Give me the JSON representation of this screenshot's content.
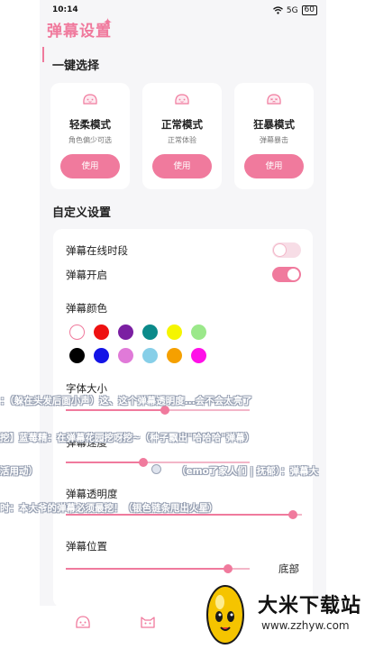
{
  "status_bar": {
    "time": "10:14",
    "wifi": "WiFi",
    "signal": "5G",
    "battery": "60"
  },
  "header": {
    "brand": "弹幕设置"
  },
  "quick_select": {
    "title": "一键选择",
    "modes": [
      {
        "name": "轻柔模式",
        "desc": "角色偏少可选",
        "button": "使用"
      },
      {
        "name": "正常模式",
        "desc": "正常体验",
        "button": "使用"
      },
      {
        "name": "狂暴模式",
        "desc": "弹幕暴击",
        "button": "使用"
      }
    ]
  },
  "custom": {
    "title": "自定义设置",
    "online_period": {
      "label": "弹幕在线时段",
      "on": false
    },
    "danmaku_on": {
      "label": "弹幕开启",
      "on": true
    },
    "color": {
      "label": "弹幕颜色",
      "swatches": [
        "#ffffff",
        "#ee1111",
        "#7b1fa2",
        "#0b8a8a",
        "#f5f500",
        "#9be88a",
        "#000000",
        "#1414e6",
        "#e07ad8",
        "#87cfe8",
        "#f5a000",
        "#ff10e8"
      ],
      "selected_index": 0
    },
    "font_size": {
      "label": "字体大小",
      "value": 0.54
    },
    "speed": {
      "label": "弹幕速度",
      "value": 0.42
    },
    "opacity": {
      "label": "弹幕透明度",
      "value": 0.96
    },
    "position": {
      "label": "弹幕位置",
      "value": 0.88,
      "value_text": "底部"
    }
  },
  "danmaku": [
    "：（躲在头发后面小声）这、这个弹幕透明度...会不会太亮了",
    "挖】蓝莓精：在弹幕花园挖呀挖~（种子飘出\"哈哈哈\"弹幕）",
    "活用动）",
    "（emo了家人们 | 抚郁）：弹幕大",
    "时：本大爷的弹幕必须最挖！（银色链条甩出火星）"
  ],
  "watermark": {
    "title": "大米下载站",
    "url": "www.zzhyw.com"
  },
  "colors": {
    "accent": "#f07a9d",
    "accent_light": "#f3b6c8",
    "toggle_off": "#f7dde6"
  },
  "icons": {
    "mode_icon": "face-icon",
    "tab_home": "face-icon",
    "tab_cat": "cat-icon"
  }
}
